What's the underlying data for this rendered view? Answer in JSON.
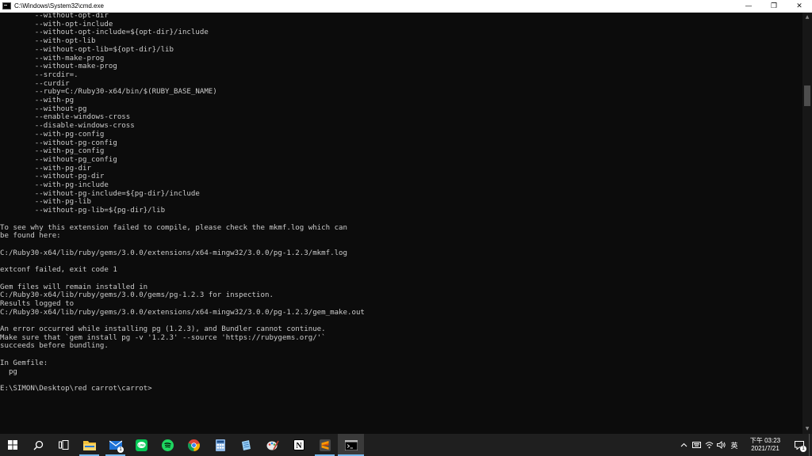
{
  "window": {
    "title": "C:\\Windows\\System32\\cmd.exe",
    "controls": {
      "minimize": "—",
      "restore": "❐",
      "close": "✕"
    }
  },
  "console": {
    "text": "        --without-opt-dir\n        --with-opt-include\n        --without-opt-include=${opt-dir}/include\n        --with-opt-lib\n        --without-opt-lib=${opt-dir}/lib\n        --with-make-prog\n        --without-make-prog\n        --srcdir=.\n        --curdir\n        --ruby=C:/Ruby30-x64/bin/$(RUBY_BASE_NAME)\n        --with-pg\n        --without-pg\n        --enable-windows-cross\n        --disable-windows-cross\n        --with-pg-config\n        --without-pg-config\n        --with-pg_config\n        --without-pg_config\n        --with-pg-dir\n        --without-pg-dir\n        --with-pg-include\n        --without-pg-include=${pg-dir}/include\n        --with-pg-lib\n        --without-pg-lib=${pg-dir}/lib\n\nTo see why this extension failed to compile, please check the mkmf.log which can\nbe found here:\n\nC:/Ruby30-x64/lib/ruby/gems/3.0.0/extensions/x64-mingw32/3.0.0/pg-1.2.3/mkmf.log\n\nextconf failed, exit code 1\n\nGem files will remain installed in\nC:/Ruby30-x64/lib/ruby/gems/3.0.0/gems/pg-1.2.3 for inspection.\nResults logged to\nC:/Ruby30-x64/lib/ruby/gems/3.0.0/extensions/x64-mingw32/3.0.0/pg-1.2.3/gem_make.out\n\nAn error occurred while installing pg (1.2.3), and Bundler cannot continue.\nMake sure that `gem install pg -v '1.2.3' --source 'https://rubygems.org/'`\nsucceeds before bundling.\n\nIn Gemfile:\n  pg\n\nE:\\SIMON\\Desktop\\red carrot\\carrot>"
  },
  "taskbar": {
    "apps": [
      {
        "name": "file-explorer-icon",
        "running": true
      },
      {
        "name": "mail-icon",
        "running": true,
        "badge": "1"
      },
      {
        "name": "line-icon",
        "running": false
      },
      {
        "name": "spotify-icon",
        "running": false
      },
      {
        "name": "chrome-icon",
        "running": false
      },
      {
        "name": "calculator-icon",
        "running": false
      },
      {
        "name": "notepad-icon",
        "running": false
      },
      {
        "name": "paint-icon",
        "running": false
      },
      {
        "name": "notion-icon",
        "running": false
      },
      {
        "name": "sublime-text-icon",
        "running": true
      },
      {
        "name": "cmd-icon",
        "running": true,
        "active": true
      }
    ],
    "tray": {
      "ime": "英",
      "time": "下午 03:23",
      "date": "2021/7/21",
      "notification_count": "1"
    }
  },
  "colors": {
    "console_bg": "#0c0c0c",
    "console_fg": "#cccccc",
    "taskbar_bg": "#1f1f1f",
    "accent": "#76b9ed"
  }
}
